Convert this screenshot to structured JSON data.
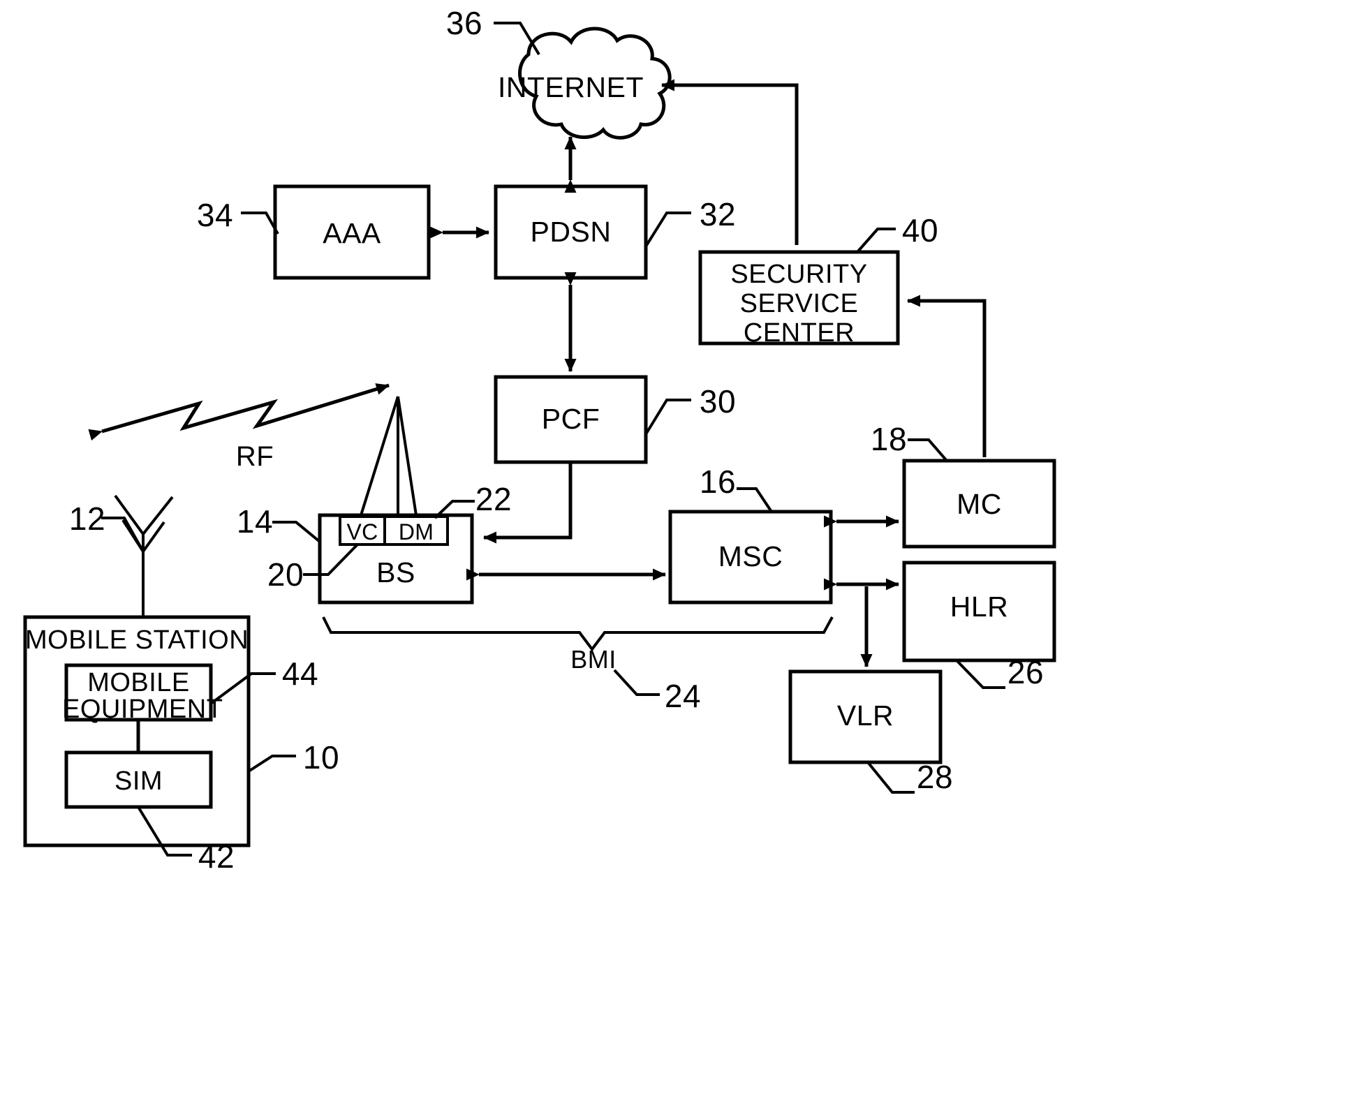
{
  "figure": {
    "title": "Mobile network security architecture block diagram",
    "stroke_color": "#000000",
    "background_color": "#ffffff"
  },
  "nodes": {
    "internet": {
      "label": "INTERNET",
      "ref": "36",
      "shape": "cloud"
    },
    "aaa": {
      "label": "AAA",
      "ref": "34",
      "shape": "rect"
    },
    "pdsn": {
      "label": "PDSN",
      "ref": "32",
      "shape": "rect"
    },
    "pcf": {
      "label": "PCF",
      "ref": "30",
      "shape": "rect"
    },
    "security_service_center": {
      "line1": "SECURITY",
      "line2": "SERVICE",
      "line3": "CENTER",
      "ref": "40",
      "shape": "rect"
    },
    "bs": {
      "label": "BS",
      "ref": "14",
      "shape": "rect"
    },
    "vc": {
      "label": "VC",
      "ref": "20",
      "shape": "rect"
    },
    "dm": {
      "label": "DM",
      "ref": "22",
      "shape": "rect"
    },
    "msc": {
      "label": "MSC",
      "ref": "16",
      "shape": "rect"
    },
    "mc": {
      "label": "MC",
      "ref": "18",
      "shape": "rect"
    },
    "hlr": {
      "label": "HLR",
      "ref": "26",
      "shape": "rect"
    },
    "vlr": {
      "label": "VLR",
      "ref": "28",
      "shape": "rect"
    },
    "mobile_station": {
      "label": "MOBILE STATION",
      "ref": "10",
      "shape": "rect"
    },
    "mobile_equipment": {
      "line1": "MOBILE",
      "line2": "EQUIPMENT",
      "ref": "44",
      "shape": "rect"
    },
    "sim": {
      "label": "SIM",
      "ref": "42",
      "shape": "rect"
    },
    "antenna": {
      "ref": "12",
      "shape": "antenna-icon"
    },
    "bs_antenna": {
      "shape": "tower-icon"
    }
  },
  "annotations": {
    "rf": {
      "label": "RF"
    },
    "bmi": {
      "label": "BMI",
      "ref": "24"
    }
  },
  "connections": [
    {
      "from": "pdsn",
      "to": "internet",
      "type": "bidirectional"
    },
    {
      "from": "aaa",
      "to": "pdsn",
      "type": "bidirectional"
    },
    {
      "from": "pdsn",
      "to": "pcf",
      "type": "bidirectional"
    },
    {
      "from": "pcf",
      "to": "bs",
      "type": "directional"
    },
    {
      "from": "bs",
      "to": "msc",
      "type": "bidirectional"
    },
    {
      "from": "msc",
      "to": "mc",
      "type": "bidirectional"
    },
    {
      "from": "msc",
      "to": "hlr",
      "type": "bidirectional"
    },
    {
      "from": "hlr",
      "to": "vlr",
      "type": "directional"
    },
    {
      "from": "security_service_center",
      "to": "internet",
      "type": "directional"
    },
    {
      "from": "mc",
      "to": "security_service_center",
      "type": "directional"
    },
    {
      "from": "mobile_equipment",
      "to": "sim",
      "type": "plain"
    },
    {
      "from": "antenna",
      "to": "bs_antenna",
      "type": "rf-lightning"
    }
  ]
}
